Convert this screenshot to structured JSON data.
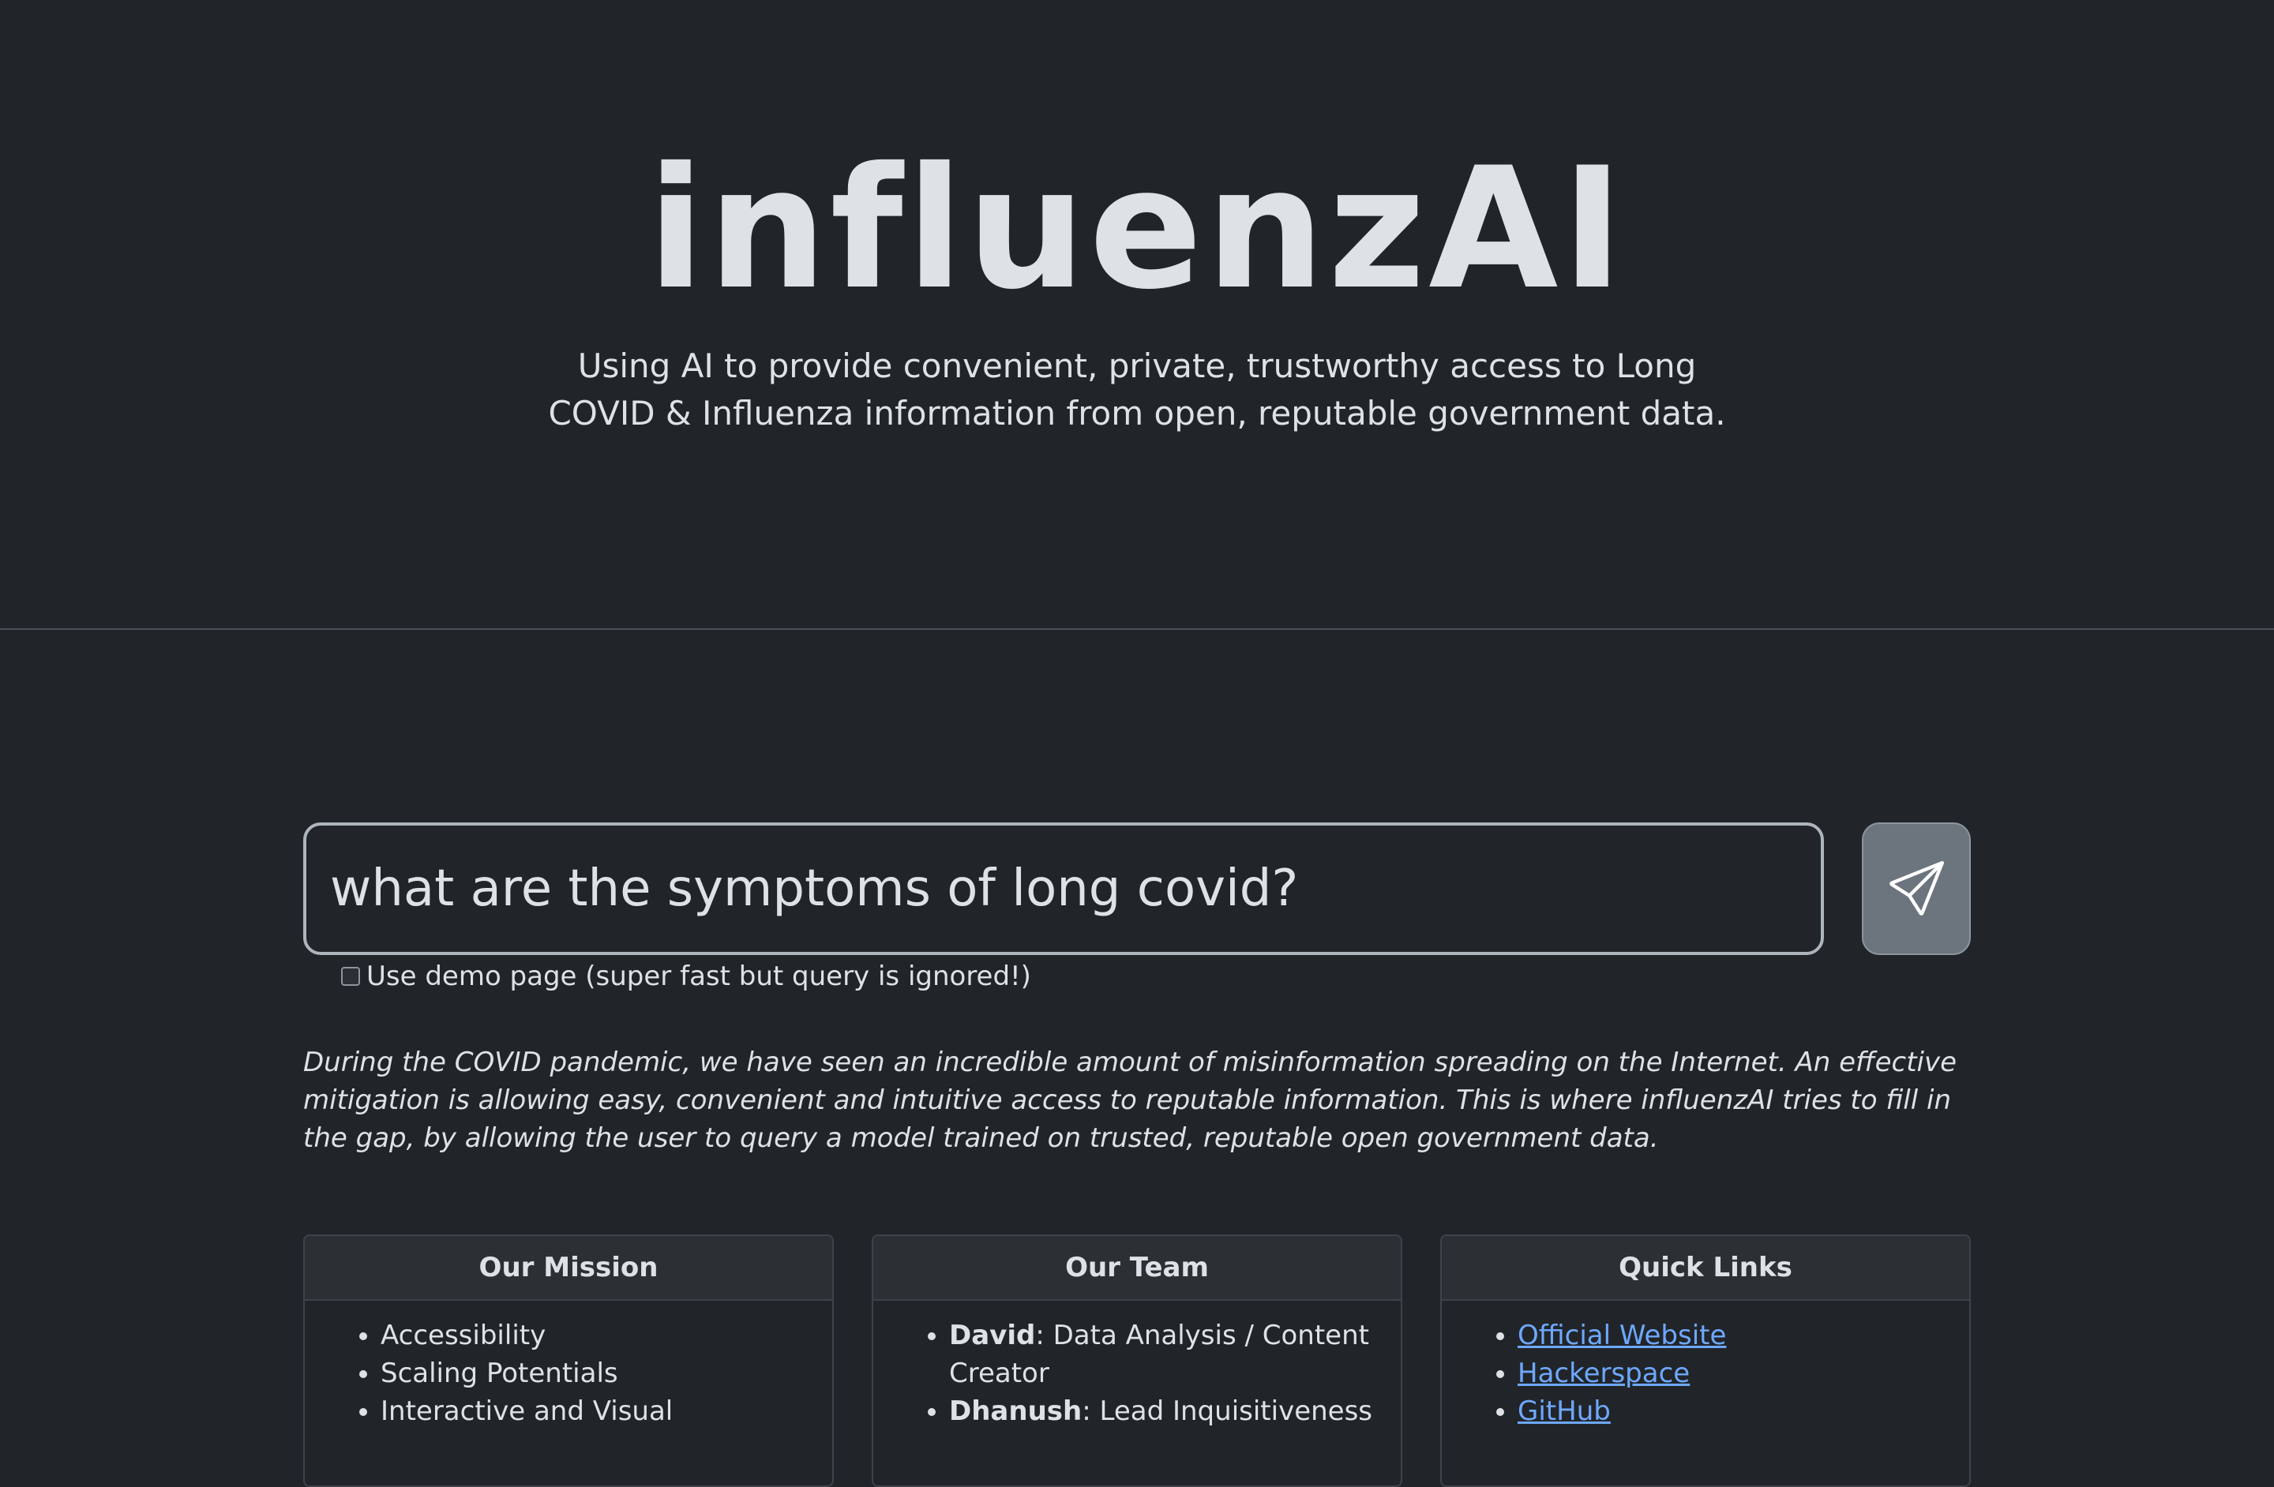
{
  "header": {
    "brand": "influenzAI",
    "tagline": "Using AI to provide convenient, private, trustworthy access to Long COVID & Influenza information from open, reputable government data."
  },
  "search": {
    "value": "what are the symptoms of long covid?",
    "submit_icon": "send-icon",
    "demo_label": "Use demo page (super fast but query is ignored!)",
    "demo_checked": false
  },
  "intro": "During the COVID pandemic, we have seen an incredible amount of misinformation spreading on the Internet. An effective mitigation is allowing easy, convenient and intuitive access to reputable information. This is where influenzAI tries to fill in the gap, by allowing the user to query a model trained on trusted, reputable open government data.",
  "cards": {
    "mission": {
      "title": "Our Mission",
      "items": [
        "Accessibility",
        "Scaling Potentials",
        "Interactive and Visual"
      ]
    },
    "team": {
      "title": "Our Team",
      "members": [
        {
          "name": "David",
          "role": ": Data Analysis / Content Creator"
        },
        {
          "name": "Dhanush",
          "role": ": Lead Inquisitiveness"
        }
      ]
    },
    "links": {
      "title": "Quick Links",
      "items": [
        "Official Website",
        "Hackerspace",
        "GitHub"
      ]
    }
  },
  "colors": {
    "background": "#212529",
    "text": "#dee2e6",
    "link": "#6ea8fe",
    "button": "#6c757d"
  }
}
